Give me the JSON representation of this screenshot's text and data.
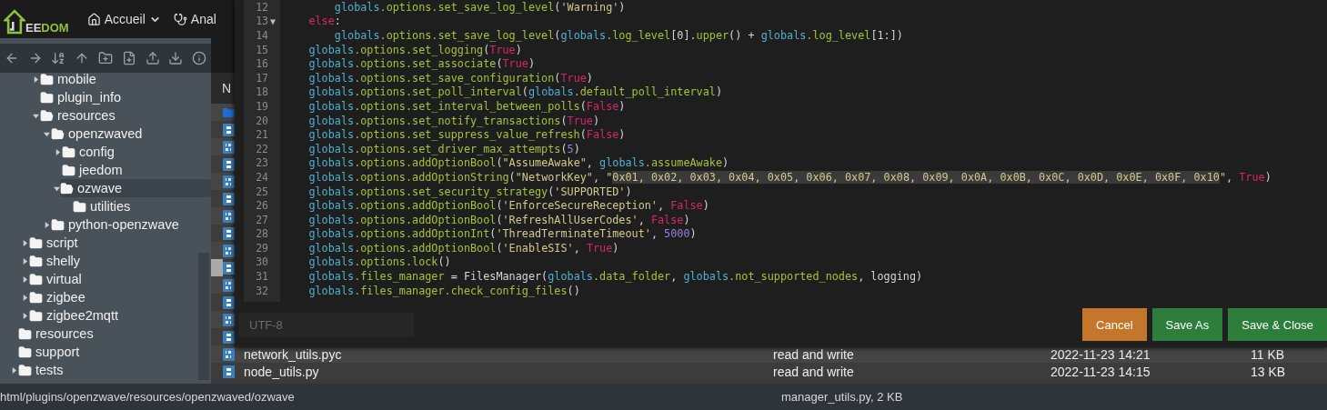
{
  "header": {
    "logo": {
      "light": "EE",
      "green": "DOM"
    },
    "nav": [
      {
        "kind": "home",
        "label": "Accueil",
        "dropdown": true
      },
      {
        "kind": "health",
        "label": "Anal",
        "dropdown": false
      }
    ]
  },
  "sidebar": {
    "toolbar": [
      {
        "kind": "back"
      },
      {
        "kind": "forward"
      },
      {
        "kind": "sort"
      },
      {
        "kind": "up"
      },
      {
        "kind": "new-folder"
      },
      {
        "kind": "new-file"
      },
      {
        "kind": "upload"
      },
      {
        "kind": "download"
      },
      {
        "kind": "info"
      }
    ],
    "tree": [
      {
        "children": [
          {
            "children": [
              {
                "label": "mobile",
                "kind": "branch",
                "expanded": false,
                "selected": false
              },
              {
                "label": "plugin_info",
                "kind": "leaf",
                "selected": false
              },
              {
                "label": "resources",
                "kind": "branch",
                "expanded": true,
                "selected": false,
                "children": [
                  {
                    "label": "openzwaved",
                    "kind": "branch",
                    "expanded": true,
                    "selected": false,
                    "children": [
                      {
                        "label": "config",
                        "kind": "branch",
                        "expanded": false,
                        "selected": false
                      },
                      {
                        "label": "jeedom",
                        "kind": "leaf",
                        "selected": false
                      },
                      {
                        "label": "ozwave",
                        "kind": "branch",
                        "expanded": true,
                        "selected": true,
                        "children": [
                          {
                            "label": "utilities",
                            "kind": "leaf",
                            "selected": false
                          }
                        ]
                      }
                    ]
                  },
                  {
                    "label": "python-openzwave",
                    "kind": "branch",
                    "expanded": false,
                    "selected": false
                  }
                ]
              }
            ]
          },
          {
            "label": "script",
            "kind": "branch",
            "expanded": false,
            "selected": false
          },
          {
            "label": "shelly",
            "kind": "branch",
            "expanded": false,
            "selected": false
          },
          {
            "label": "virtual",
            "kind": "branch",
            "expanded": false,
            "selected": false
          },
          {
            "label": "zigbee",
            "kind": "branch",
            "expanded": false,
            "selected": false
          },
          {
            "label": "zigbee2mqtt",
            "kind": "branch",
            "expanded": false,
            "selected": false
          }
        ]
      },
      {
        "label": "resources",
        "kind": "leaf",
        "selected": false
      },
      {
        "label": "support",
        "kind": "leaf",
        "selected": false
      },
      {
        "label": "tests",
        "kind": "branch",
        "expanded": false,
        "selected": false
      }
    ]
  },
  "files": {
    "header": "N",
    "rows": [
      {
        "kind": "folder",
        "selected": false
      },
      {
        "kind": "python",
        "selected": false
      },
      {
        "kind": "binary",
        "selected": false
      },
      {
        "kind": "python",
        "selected": false
      },
      {
        "kind": "binary",
        "selected": false
      },
      {
        "kind": "python",
        "selected": false
      },
      {
        "kind": "binary",
        "selected": false
      },
      {
        "kind": "python",
        "selected": false
      },
      {
        "kind": "binary",
        "selected": false
      },
      {
        "kind": "python",
        "selected": true
      },
      {
        "kind": "binary",
        "selected": false
      },
      {
        "kind": "python",
        "selected": false
      },
      {
        "kind": "binary",
        "selected": false
      },
      {
        "kind": "python",
        "selected": false
      },
      {
        "kind": "binary",
        "selected": false,
        "name": "network_utils.pyc",
        "permissions": "read and write",
        "modified": "2022-11-23 14:21",
        "size": "11 KB"
      },
      {
        "kind": "python",
        "selected": false,
        "name": "node_utils.py",
        "permissions": "read and write",
        "modified": "2022-11-23 14:15",
        "size": "13 KB"
      }
    ]
  },
  "status_bar": {
    "path": "html/plugins/openzwave/resources/openzwaved/ozwave",
    "file": "manager_utils.py, 2 KB"
  },
  "editor": {
    "lines": [
      {
        "n": "12",
        "tokens": [
          {
            "kind": "var",
            "text": "        globals"
          },
          {
            "kind": "attr",
            "text": ".options.set_save_log_level"
          },
          {
            "kind": "plain",
            "text": "("
          },
          {
            "kind": "str",
            "text": "'Warning'"
          },
          {
            "kind": "plain",
            "text": ")"
          }
        ]
      },
      {
        "n": "13",
        "fold": "▼",
        "tokens": [
          {
            "kind": "kw",
            "text": "    else"
          },
          {
            "kind": "plain",
            "text": ":"
          }
        ]
      },
      {
        "n": "14",
        "tokens": [
          {
            "kind": "var",
            "text": "        globals"
          },
          {
            "kind": "attr",
            "text": ".options.set_save_log_level"
          },
          {
            "kind": "plain",
            "text": "("
          },
          {
            "kind": "var",
            "text": "globals"
          },
          {
            "kind": "attr",
            "text": ".log_level"
          },
          {
            "kind": "plain",
            "text": "[0]."
          },
          {
            "kind": "attr",
            "text": "upper"
          },
          {
            "kind": "plain",
            "text": "() + "
          },
          {
            "kind": "var",
            "text": "globals"
          },
          {
            "kind": "attr",
            "text": ".log_level"
          },
          {
            "kind": "plain",
            "text": "[1:])"
          }
        ]
      },
      {
        "n": "15",
        "tokens": [
          {
            "kind": "var",
            "text": "    globals"
          },
          {
            "kind": "attr",
            "text": ".options.set_logging"
          },
          {
            "kind": "plain",
            "text": "("
          },
          {
            "kind": "kw",
            "text": "True"
          },
          {
            "kind": "plain",
            "text": ")"
          }
        ]
      },
      {
        "n": "16",
        "tokens": [
          {
            "kind": "var",
            "text": "    globals"
          },
          {
            "kind": "attr",
            "text": ".options.set_associate"
          },
          {
            "kind": "plain",
            "text": "("
          },
          {
            "kind": "kw",
            "text": "True"
          },
          {
            "kind": "plain",
            "text": ")"
          }
        ]
      },
      {
        "n": "17",
        "tokens": [
          {
            "kind": "var",
            "text": "    globals"
          },
          {
            "kind": "attr",
            "text": ".options.set_save_configuration"
          },
          {
            "kind": "plain",
            "text": "("
          },
          {
            "kind": "kw",
            "text": "True"
          },
          {
            "kind": "plain",
            "text": ")"
          }
        ]
      },
      {
        "n": "18",
        "tokens": [
          {
            "kind": "var",
            "text": "    globals"
          },
          {
            "kind": "attr",
            "text": ".options.set_poll_interval"
          },
          {
            "kind": "plain",
            "text": "("
          },
          {
            "kind": "var",
            "text": "globals"
          },
          {
            "kind": "attr",
            "text": ".default_poll_interval"
          },
          {
            "kind": "plain",
            "text": ")"
          }
        ]
      },
      {
        "n": "19",
        "tokens": [
          {
            "kind": "var",
            "text": "    globals"
          },
          {
            "kind": "attr",
            "text": ".options.set_interval_between_polls"
          },
          {
            "kind": "plain",
            "text": "("
          },
          {
            "kind": "kw",
            "text": "False"
          },
          {
            "kind": "plain",
            "text": ")"
          }
        ]
      },
      {
        "n": "20",
        "tokens": [
          {
            "kind": "var",
            "text": "    globals"
          },
          {
            "kind": "attr",
            "text": ".options.set_notify_transactions"
          },
          {
            "kind": "plain",
            "text": "("
          },
          {
            "kind": "kw",
            "text": "True"
          },
          {
            "kind": "plain",
            "text": ")"
          }
        ]
      },
      {
        "n": "21",
        "tokens": [
          {
            "kind": "var",
            "text": "    globals"
          },
          {
            "kind": "attr",
            "text": ".options.set_suppress_value_refresh"
          },
          {
            "kind": "plain",
            "text": "("
          },
          {
            "kind": "kw",
            "text": "False"
          },
          {
            "kind": "plain",
            "text": ")"
          }
        ]
      },
      {
        "n": "22",
        "tokens": [
          {
            "kind": "var",
            "text": "    globals"
          },
          {
            "kind": "attr",
            "text": ".options.set_driver_max_attempts"
          },
          {
            "kind": "plain",
            "text": "("
          },
          {
            "kind": "num",
            "text": "5"
          },
          {
            "kind": "plain",
            "text": ")"
          }
        ]
      },
      {
        "n": "23",
        "tokens": [
          {
            "kind": "var",
            "text": "    globals"
          },
          {
            "kind": "attr",
            "text": ".options.addOptionBool"
          },
          {
            "kind": "plain",
            "text": "("
          },
          {
            "kind": "str",
            "text": "\"AssumeAwake\""
          },
          {
            "kind": "plain",
            "text": ", "
          },
          {
            "kind": "var",
            "text": "globals"
          },
          {
            "kind": "attr",
            "text": ".assumeAwake"
          },
          {
            "kind": "plain",
            "text": ")"
          }
        ]
      },
      {
        "n": "24",
        "tokens": [
          {
            "kind": "var",
            "text": "    globals"
          },
          {
            "kind": "attr",
            "text": ".options.addOptionString"
          },
          {
            "kind": "plain",
            "text": "("
          },
          {
            "kind": "str",
            "text": "\"NetworkKey\""
          },
          {
            "kind": "plain",
            "text": ", "
          },
          {
            "kind": "str",
            "text": "\""
          },
          {
            "kind": "sel",
            "text": "0x01, 0x02, 0x03, 0x04, 0x05, 0x06, 0x07, 0x08, 0x09, 0x0A, 0x0B, 0x0C, 0x0D, 0x0E, 0x0F, 0x10"
          },
          {
            "kind": "str",
            "text": "\""
          },
          {
            "kind": "plain",
            "text": ", "
          },
          {
            "kind": "kw",
            "text": "True"
          },
          {
            "kind": "plain",
            "text": ")"
          }
        ]
      },
      {
        "n": "25",
        "tokens": [
          {
            "kind": "var",
            "text": "    globals"
          },
          {
            "kind": "attr",
            "text": ".options.set_security_strategy"
          },
          {
            "kind": "plain",
            "text": "("
          },
          {
            "kind": "str",
            "text": "'SUPPORTED'"
          },
          {
            "kind": "plain",
            "text": ")"
          }
        ]
      },
      {
        "n": "26",
        "tokens": [
          {
            "kind": "var",
            "text": "    globals"
          },
          {
            "kind": "attr",
            "text": ".options.addOptionBool"
          },
          {
            "kind": "plain",
            "text": "("
          },
          {
            "kind": "str",
            "text": "'EnforceSecureReception'"
          },
          {
            "kind": "plain",
            "text": ", "
          },
          {
            "kind": "kw",
            "text": "False"
          },
          {
            "kind": "plain",
            "text": ")"
          }
        ]
      },
      {
        "n": "27",
        "tokens": [
          {
            "kind": "var",
            "text": "    globals"
          },
          {
            "kind": "attr",
            "text": ".options.addOptionBool"
          },
          {
            "kind": "plain",
            "text": "("
          },
          {
            "kind": "str",
            "text": "'RefreshAllUserCodes'"
          },
          {
            "kind": "plain",
            "text": ", "
          },
          {
            "kind": "kw",
            "text": "False"
          },
          {
            "kind": "plain",
            "text": ")"
          }
        ]
      },
      {
        "n": "28",
        "tokens": [
          {
            "kind": "var",
            "text": "    globals"
          },
          {
            "kind": "attr",
            "text": ".options.addOptionInt"
          },
          {
            "kind": "plain",
            "text": "("
          },
          {
            "kind": "str",
            "text": "'ThreadTerminateTimeout'"
          },
          {
            "kind": "plain",
            "text": ", "
          },
          {
            "kind": "num",
            "text": "5000"
          },
          {
            "kind": "plain",
            "text": ")"
          }
        ]
      },
      {
        "n": "29",
        "tokens": [
          {
            "kind": "var",
            "text": "    globals"
          },
          {
            "kind": "attr",
            "text": ".options.addOptionBool"
          },
          {
            "kind": "plain",
            "text": "("
          },
          {
            "kind": "str",
            "text": "'EnableSIS'"
          },
          {
            "kind": "plain",
            "text": ", "
          },
          {
            "kind": "kw",
            "text": "True"
          },
          {
            "kind": "plain",
            "text": ")"
          }
        ]
      },
      {
        "n": "30",
        "tokens": [
          {
            "kind": "var",
            "text": "    globals"
          },
          {
            "kind": "attr",
            "text": ".options.lock"
          },
          {
            "kind": "plain",
            "text": "()"
          }
        ]
      },
      {
        "n": "31",
        "tokens": [
          {
            "kind": "var",
            "text": "    globals"
          },
          {
            "kind": "attr",
            "text": ".files_manager"
          },
          {
            "kind": "plain",
            "text": " = FilesManager("
          },
          {
            "kind": "var",
            "text": "globals"
          },
          {
            "kind": "attr",
            "text": ".data_folder"
          },
          {
            "kind": "plain",
            "text": ", "
          },
          {
            "kind": "var",
            "text": "globals"
          },
          {
            "kind": "attr",
            "text": ".not_supported_nodes"
          },
          {
            "kind": "plain",
            "text": ", logging)"
          }
        ]
      },
      {
        "n": "32",
        "tokens": [
          {
            "kind": "var",
            "text": "    globals"
          },
          {
            "kind": "attr",
            "text": ".files_manager.check_config_files"
          },
          {
            "kind": "plain",
            "text": "()"
          }
        ]
      }
    ],
    "encoding": {
      "placeholder": "UTF-8"
    },
    "buttons": [
      {
        "kind": "cancel",
        "label": "Cancel"
      },
      {
        "kind": "save",
        "label": "Save As"
      },
      {
        "kind": "save",
        "label": "Save & Close"
      }
    ]
  }
}
